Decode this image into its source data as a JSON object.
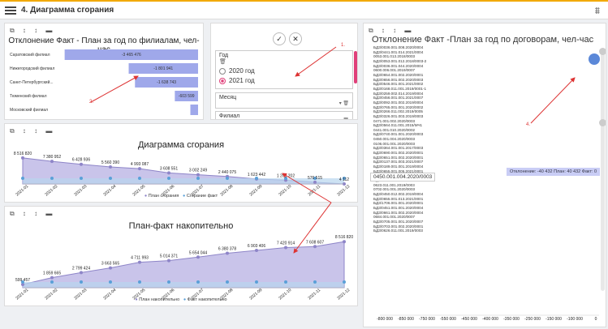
{
  "header": {
    "title": "4. Диаграмма сгорания"
  },
  "toolbar_glyphs": "⧉ ↕ ↕ ▬",
  "branches": {
    "title": "Отклонение Факт - План за год по филиалам, чел-час",
    "rows": [
      {
        "label": "Саратовский филиал",
        "value_text": "-3 465 476",
        "value": -3465476
      },
      {
        "label": "Нижегородский филиал",
        "value_text": "-1 801 941",
        "value": -1801941
      },
      {
        "label": "Санкт-Петербургский...",
        "value_text": "-1 638 743",
        "value": -1638743
      },
      {
        "label": "Тюменский филиал",
        "value_text": "-603 599",
        "value": -603599
      },
      {
        "label": "Московский филиал",
        "value_text": "",
        "value": -200000
      }
    ],
    "note": "2."
  },
  "filters": {
    "note": "1.",
    "year_label": "Год",
    "years": [
      {
        "label": "2020 год",
        "selected": false
      },
      {
        "label": "2021 год",
        "selected": true
      }
    ],
    "month_label": "Месяц",
    "branch_label": "Филиал"
  },
  "burn": {
    "title": "Диаграмма сгорания",
    "legend": [
      "План сгорания",
      "Сгорание факт"
    ],
    "colors": {
      "plan": "#8e85c8",
      "fact": "#5aa0d8"
    },
    "chart_data": {
      "type": "area",
      "title": "Диаграмма сгорания",
      "categories": [
        "2021-01",
        "2021-02",
        "2021-03",
        "2021-04",
        "2021-05",
        "2021-06",
        "2021-07",
        "2021-08",
        "2021-09",
        "2021-10",
        "2021-11",
        "2021-12"
      ],
      "series": [
        {
          "name": "План сгорания",
          "values": [
            8516820,
            7380952,
            6428936,
            5560390,
            4993087,
            3608551,
            3002249,
            2440075,
            1623442,
            1208202,
            576515,
            4112
          ]
        },
        {
          "name": "Сгорание факт",
          "values": [
            null,
            null,
            null,
            null,
            null,
            null,
            null,
            null,
            null,
            null,
            null,
            null
          ]
        }
      ],
      "labels": [
        "8 516 820",
        "7 380 952",
        "6 428 936",
        "5 560 390",
        "4 993 087",
        "3 608 551",
        "3 002 249",
        "2 440 075",
        "1 623 442",
        "1 208 202",
        "576 515",
        "4 112"
      ]
    },
    "note": "3."
  },
  "cumul": {
    "title": "План-факт накопительно",
    "legend": [
      "План накопительно",
      "Факт накопительно"
    ],
    "chart_data": {
      "type": "area",
      "title": "План-факт накопительно",
      "categories": [
        "2021-01",
        "2021-02",
        "2021-03",
        "2021-04",
        "2021-05",
        "2021-06",
        "2021-07",
        "2021-08",
        "2021-09",
        "2021-10",
        "2021-11",
        "2021-12"
      ],
      "series": [
        {
          "name": "План накопительно",
          "values": [
            599457,
            1859665,
            2799424,
            3663565,
            4711993,
            5014371,
            5654044,
            6380378,
            6903406,
            7420914,
            7608607,
            8516820
          ]
        },
        {
          "name": "Факт накопительно",
          "values": [
            null,
            null,
            null,
            null,
            null,
            null,
            null,
            null,
            null,
            null,
            null,
            null
          ]
        }
      ],
      "labels": [
        "599 457",
        "1 859 665",
        "2 799 424",
        "3 663 565",
        "4 711 993",
        "5 014 371",
        "5 654 044",
        "6 380 378",
        "6 903 406",
        "7 420 914",
        "7 608 607",
        "8 516 820"
      ]
    }
  },
  "contracts": {
    "title": "Отклонение Факт -План за год по договорам, чел-час",
    "tooltip": "Отклонение: -40 432 План: 40 432 Факт: 0",
    "tooltip_name": "0450.001.004.2020/0003",
    "note": "4.",
    "items": [
      "БДЗ/0036.001.008.2020/0004",
      "БДЗ/0441.001.014.2021/0004",
      "0053.001.013.2018/0003",
      "БДЗ/0053.001.012.2018/0003-2",
      "БДЗ/0036.001.044.2020/0004",
      "0600.006.001.2019/0007",
      "БДЗ/0654.001.002.2020/0001",
      "БДЗ/0656.001.002.2020/0003",
      "БДЗ/0546.001.001.2021/0002",
      "БДЗ/0168.011.001.2019/0001-1",
      "БДЗ/0259.002.014.2019/0004",
      "БДЗ/0456.001.001.2021/0007",
      "БДЗ/0092.001.002.2019/0004",
      "БДЗ/0765.001.001.2020/0002",
      "БДЗ/0266.011.002.2019/0005",
      "БДЗ/0326.001.003.2019/0003",
      "0471.001.002.2020/0003",
      "БДЗ/0564.011.001.2015/МЧ1",
      "0441.001.010.2020/0002",
      "БДЗ/0740.001.001.2020/0003",
      "0450.001.004.2020/0003",
      "0106.001.001.2020/0003",
      "БДЗ/0364.001.001.2017/0003",
      "БДЗ/0690.001.002.2020/0001",
      "БДЗ/0651.001.002.2020/0001",
      "БДЗ/0137.001.003.2021/0007",
      "БДЗ/0189.001.001.2019/0004",
      "БДЗ/0655.001.005.2021/0001",
      "БДЗ/0655.001.006.2021/0001",
      "БДЗ/0108.001.005.2020/0004",
      "0623.011.001.2019/0003",
      "0702.001.001.2020/0003",
      "БДЗ/0450.012.002.2019/0004",
      "БДЗ/0655.001.013.2021/0001",
      "БДЗ/1706.001.001.2020/0001",
      "БДЗ/0451.001.001.2020/0004",
      "БДЗ/0661.001.002.2020/0004",
      "0684.001.001.2020/0007",
      "БДЗ/0705.001.001.2020/0007",
      "БДЗ/0703.001.002.2020/0001",
      "БДЗ/0626.011.001.2019/0003"
    ],
    "x_ticks": [
      "-800 000",
      "-850 000",
      "-750 000",
      "-550 000",
      "-450 000",
      "-400 000",
      "-350 000",
      "-250 000",
      "-150 000",
      "-100 000",
      "0"
    ]
  }
}
